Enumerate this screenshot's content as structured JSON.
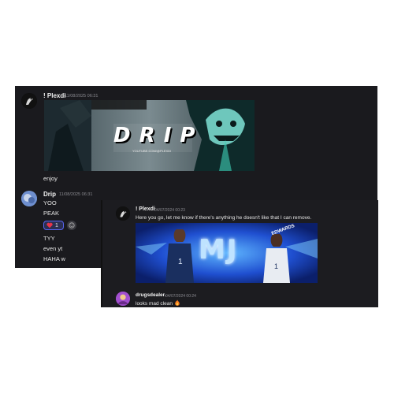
{
  "back_panel": {
    "post1": {
      "username": "! Plexdi",
      "timestamp": "11/08/2025 06:31",
      "banner_text": "D R I P",
      "banner_subtext": "YOUTUBE.COM/@PLEXDI",
      "message": "enjoy"
    },
    "post2": {
      "username": "Drip",
      "timestamp": "11/08/2025 06:31",
      "messages": [
        "YOO",
        "PEAK",
        "TYY",
        "even yt",
        "HAHA w"
      ],
      "reaction_count": "1"
    }
  },
  "front_panel": {
    "post1": {
      "username": "! Plexdi",
      "timestamp": "04/07/2024 00:23",
      "message": "Here you go, let me know if there's anything he doesn't like that I can remove.",
      "banner_text": "MJ",
      "banner_name": "EDWARDS"
    },
    "post2": {
      "username": "drugsdealer.",
      "timestamp": "04/07/2024 00:24",
      "message": "looks mad clean"
    }
  },
  "colors": {
    "panel_bg": "#1a1a1e",
    "accent_purple": "#c35cf2",
    "reaction_blue": "#5865f2",
    "banner_blue": "#1f4fd0"
  }
}
